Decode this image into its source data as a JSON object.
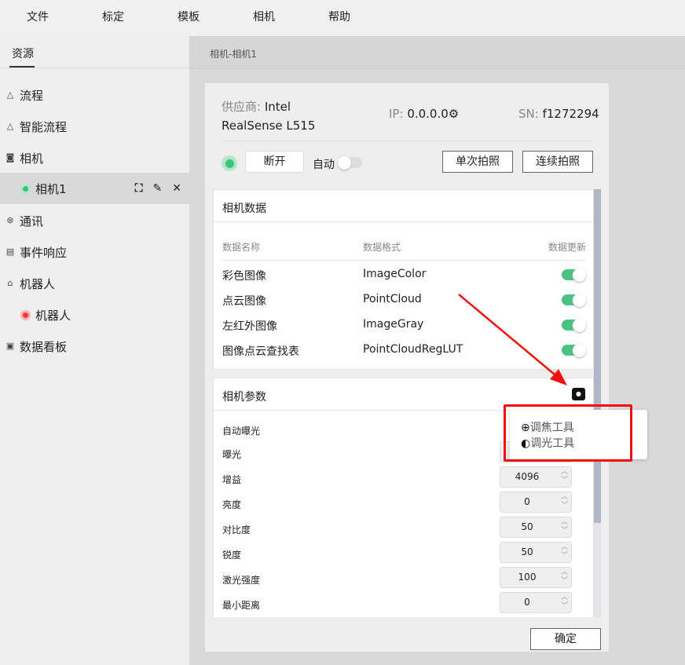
{
  "menu": [
    "文件",
    "标定",
    "模板",
    "相机",
    "帮助"
  ],
  "sidebar": {
    "tab": "资源",
    "items": [
      {
        "label": "流程",
        "icon": "flow-icon"
      },
      {
        "label": "智能流程",
        "icon": "smart-flow-icon"
      },
      {
        "label": "相机",
        "icon": "camera-icon"
      },
      {
        "label": "相机1",
        "status": "connected",
        "selected": true
      },
      {
        "label": "通讯",
        "icon": "communication-icon"
      },
      {
        "label": "事件响应",
        "icon": "event-icon"
      },
      {
        "label": "机器人",
        "icon": "robot-icon"
      },
      {
        "label": "机器人",
        "status": "disconnected"
      },
      {
        "label": "数据看板",
        "icon": "dashboard-icon"
      }
    ]
  },
  "breadcrumb": "相机-相机1",
  "camera": {
    "vendor_label": "供应商:",
    "vendor": "Intel",
    "model": "RealSense L515",
    "ip_label": "IP:",
    "ip": "0.0.0.0",
    "sn_label": "SN:",
    "sn": "f1272294",
    "disconnect": "断开",
    "auto": "自动",
    "auto_on": false,
    "single_shot": "单次拍照",
    "continuous_shot": "连续拍照"
  },
  "data_card": {
    "title": "相机数据",
    "headers": [
      "数据名称",
      "数据格式",
      "数据更新"
    ],
    "rows": [
      {
        "name": "彩色图像",
        "format": "ImageColor",
        "update": true
      },
      {
        "name": "点云图像",
        "format": "PointCloud",
        "update": true
      },
      {
        "name": "左红外图像",
        "format": "ImageGray",
        "update": true
      },
      {
        "name": "图像点云查找表",
        "format": "PointCloudRegLUT",
        "update": true
      }
    ]
  },
  "param_card": {
    "title": "相机参数",
    "rows": [
      {
        "name": "自动曝光",
        "value": ""
      },
      {
        "name": "曝光",
        "value": ""
      },
      {
        "name": "增益",
        "value": "4096"
      },
      {
        "name": "亮度",
        "value": "0"
      },
      {
        "name": "对比度",
        "value": "50"
      },
      {
        "name": "锐度",
        "value": "50"
      },
      {
        "name": "激光强度",
        "value": "100"
      },
      {
        "name": "最小距离",
        "value": "0"
      }
    ]
  },
  "popup": {
    "items": [
      "调焦工具",
      "调光工具"
    ]
  },
  "confirm": "确定",
  "colors": {
    "connected": "#3cc47c",
    "disconnected": "#f03a3a",
    "annotation": "#f01010"
  }
}
